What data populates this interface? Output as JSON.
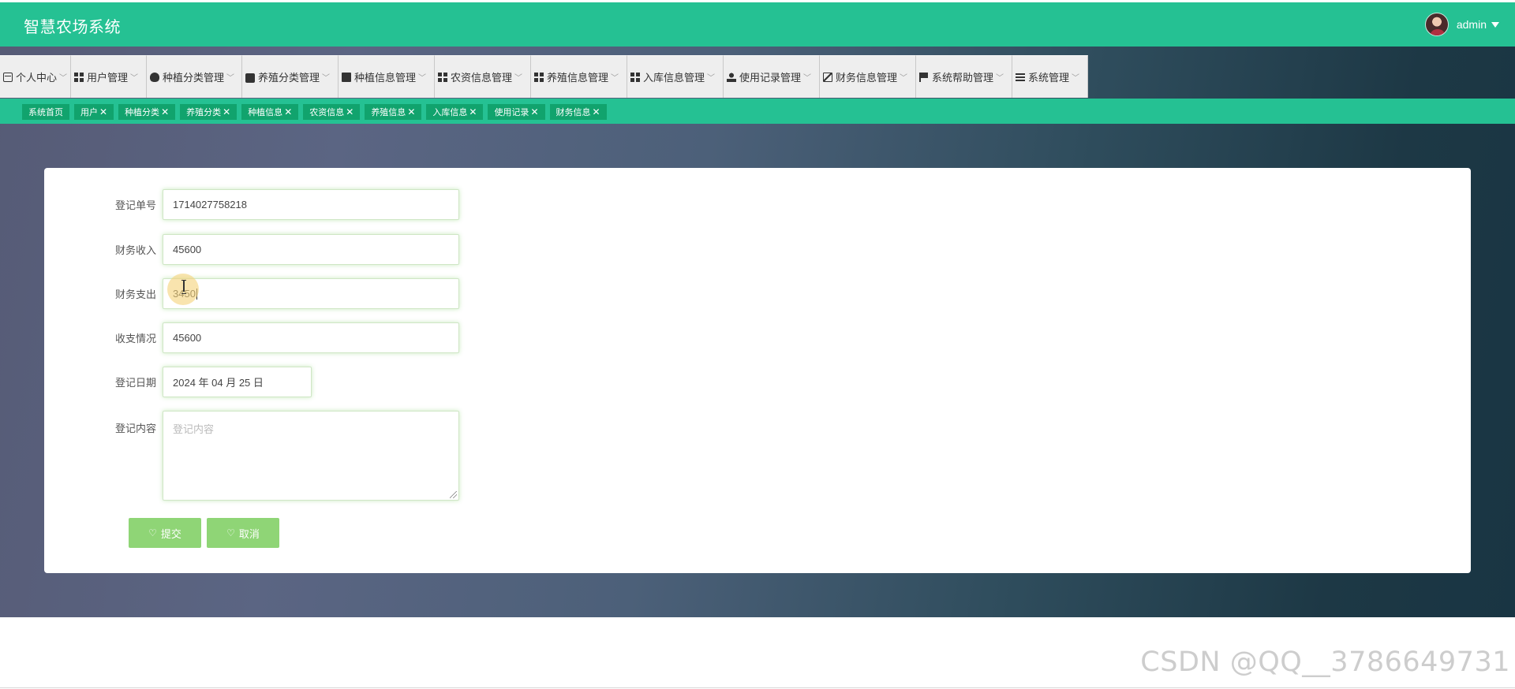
{
  "header": {
    "title": "智慧农场系统",
    "username": "admin"
  },
  "nav": [
    {
      "label": "个人中心",
      "icon": "id-card-icon"
    },
    {
      "label": "用户管理",
      "icon": "grid-icon"
    },
    {
      "label": "种植分类管理",
      "icon": "bulb-icon"
    },
    {
      "label": "养殖分类管理",
      "icon": "chat-icon"
    },
    {
      "label": "种植信息管理",
      "icon": "monitor-icon"
    },
    {
      "label": "农资信息管理",
      "icon": "grid-icon"
    },
    {
      "label": "养殖信息管理",
      "icon": "grid-icon"
    },
    {
      "label": "入库信息管理",
      "icon": "grid-icon"
    },
    {
      "label": "使用记录管理",
      "icon": "user-icon"
    },
    {
      "label": "财务信息管理",
      "icon": "box-icon"
    },
    {
      "label": "系统帮助管理",
      "icon": "flag-icon"
    },
    {
      "label": "系统管理",
      "icon": "bars-icon"
    }
  ],
  "tabs": [
    {
      "label": "系统首页",
      "closable": false
    },
    {
      "label": "用户",
      "closable": true
    },
    {
      "label": "种植分类",
      "closable": true
    },
    {
      "label": "养殖分类",
      "closable": true
    },
    {
      "label": "种植信息",
      "closable": true
    },
    {
      "label": "农资信息",
      "closable": true
    },
    {
      "label": "养殖信息",
      "closable": true
    },
    {
      "label": "入库信息",
      "closable": true
    },
    {
      "label": "使用记录",
      "closable": true
    },
    {
      "label": "财务信息",
      "closable": true
    }
  ],
  "form": {
    "order_no": {
      "label": "登记单号",
      "value": "1714027758218"
    },
    "income": {
      "label": "财务收入",
      "value": "45600"
    },
    "expense": {
      "label": "财务支出",
      "value": "3450"
    },
    "balance": {
      "label": "收支情况",
      "value": "45600"
    },
    "date": {
      "label": "登记日期",
      "value": "2024 年 04 月 25 日"
    },
    "content": {
      "label": "登记内容",
      "placeholder": "登记内容",
      "value": ""
    },
    "submit_label": "提交",
    "cancel_label": "取消"
  },
  "watermark": "CSDN @QQ__3786649731",
  "colors": {
    "header": "#25c193",
    "tab": "#11a36d",
    "button": "#8fd576"
  }
}
